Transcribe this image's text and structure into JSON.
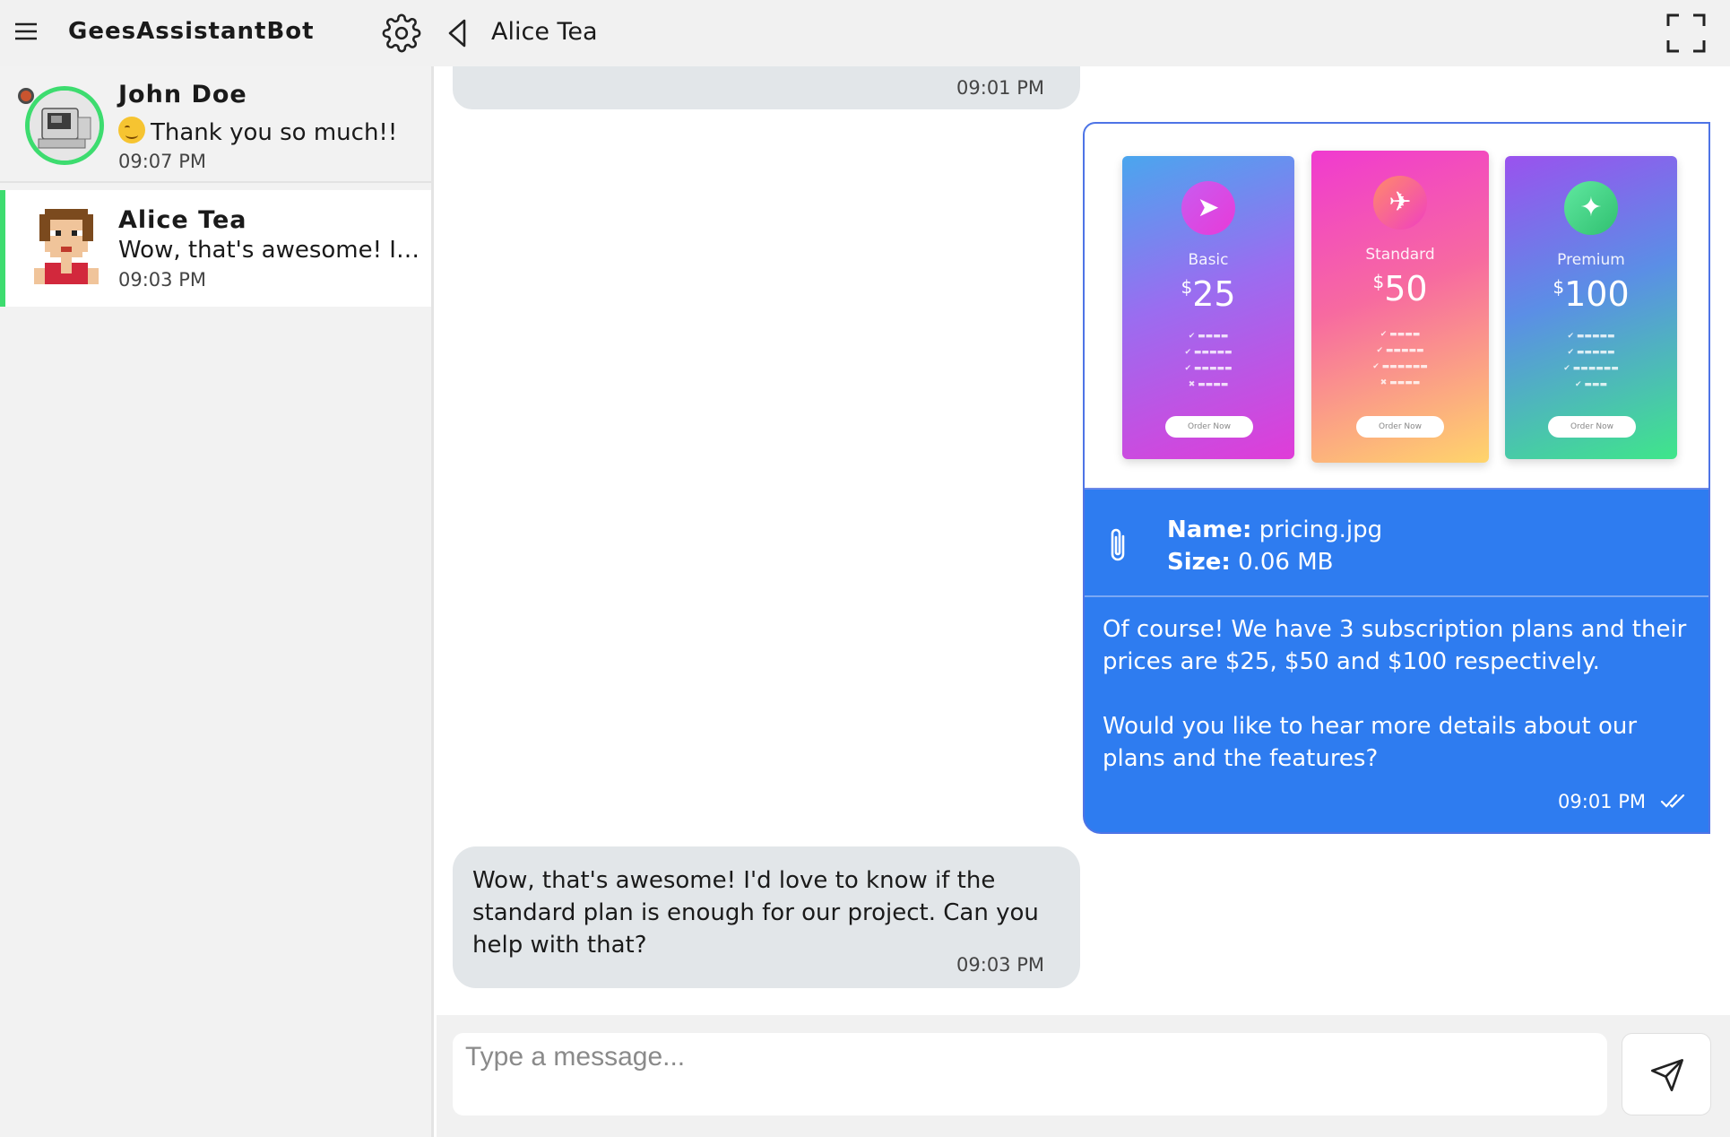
{
  "header": {
    "app_title": "GeesAssistantBot",
    "chat_title": "Alice Tea",
    "icons": [
      "menu-icon",
      "gear-icon",
      "back-triangle-icon",
      "fullscreen-icon"
    ]
  },
  "sidebar": {
    "contacts": [
      {
        "name": "John Doe",
        "preview": "Thank you so much!!",
        "time": "09:07 PM",
        "status": "away",
        "active": false
      },
      {
        "name": "Alice Tea",
        "preview": "Wow, that's awesome! I'd ...",
        "time": "09:03 PM",
        "active": true
      }
    ]
  },
  "messages": [
    {
      "direction": "in",
      "text": "",
      "time": "09:01 PM"
    },
    {
      "direction": "out",
      "attachment": {
        "name_label": "Name:",
        "name_value": "pricing.jpg",
        "size_label": "Size:",
        "size_value": "0.06 MB",
        "image": {
          "plans": [
            {
              "name": "Basic",
              "currency": "$",
              "price": "25",
              "order_label": "Order Now"
            },
            {
              "name": "Standard",
              "currency": "$",
              "price": "50",
              "order_label": "Order Now"
            },
            {
              "name": "Premium",
              "currency": "$",
              "price": "100",
              "order_label": "Order Now"
            }
          ]
        }
      },
      "paragraphs": [
        "Of course! We have 3 subscription plans and their prices are $25, $50 and $100 respectively.",
        "Would you like to hear more details about our plans and the features?"
      ],
      "time": "09:01 PM",
      "read": true
    },
    {
      "direction": "in",
      "text": "Wow, that's awesome! I'd love to know if the standard plan is enough for our project. Can you help with that?",
      "time": "09:03 PM"
    }
  ],
  "composer": {
    "placeholder": "Type a message...",
    "value": ""
  },
  "colors": {
    "accent_green": "#3ddc6f",
    "outgoing_blue": "#2e7cf0",
    "incoming_gray": "#e2e6e9",
    "status_dot": "#c9542f"
  }
}
